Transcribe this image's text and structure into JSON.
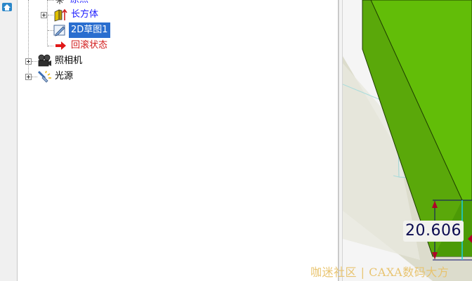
{
  "tree": {
    "items": [
      {
        "label": "原点",
        "color": "#1a1aff",
        "icon": "origin-icon"
      },
      {
        "label": "长方体",
        "color": "#1a1aff",
        "icon": "box-solid-icon"
      },
      {
        "label": "2D草图1",
        "color": "#ffffff",
        "selected_bg": "#2a6ecf",
        "icon": "sketch-pencil-icon"
      },
      {
        "label": "回滚状态",
        "color": "#d21b1b",
        "icon": "rollback-arrow-icon"
      },
      {
        "label": "照相机",
        "color": "#000000",
        "icon": "camera-icon"
      },
      {
        "label": "光源",
        "color": "#000000",
        "icon": "light-source-icon"
      }
    ]
  },
  "viewport": {
    "dimension_value": "20.606",
    "solid_color": "#5fb10a",
    "shadow_color": "#dcdccc"
  },
  "watermark": "咖迷社区 | CAXA数码大方"
}
